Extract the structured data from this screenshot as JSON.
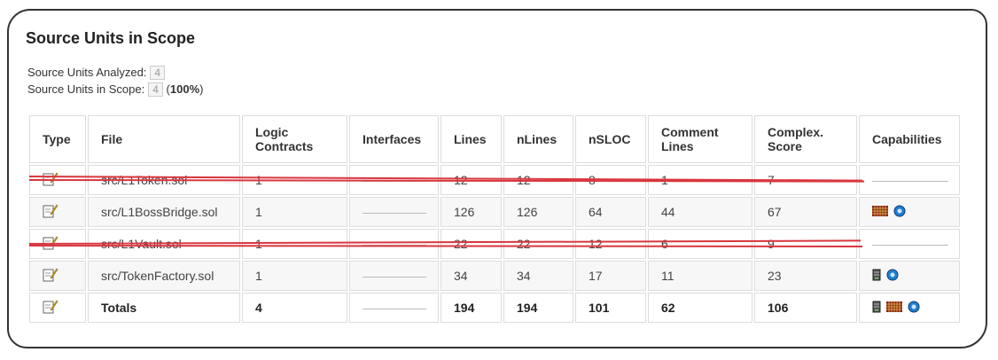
{
  "section_title": "Source Units in Scope",
  "analyzed": {
    "label": "Source Units Analyzed:",
    "value": "4"
  },
  "in_scope": {
    "label": "Source Units in Scope:",
    "value": "4",
    "percent_open": "(",
    "percent": "100%",
    "percent_close": ")"
  },
  "table": {
    "headers": [
      "Type",
      "File",
      "Logic Contracts",
      "Interfaces",
      "Lines",
      "nLines",
      "nSLOC",
      "Comment Lines",
      "Complex. Score",
      "Capabilities"
    ],
    "rows": [
      {
        "file": "src/L1Token.sol",
        "logic": "1",
        "lines": "12",
        "nlines": "12",
        "nsloc": "8",
        "comment": "1",
        "complex": "7",
        "struck": true
      },
      {
        "file": "src/L1BossBridge.sol",
        "logic": "1",
        "lines": "126",
        "nlines": "126",
        "nsloc": "64",
        "comment": "44",
        "complex": "67",
        "struck": false
      },
      {
        "file": "src/L1Vault.sol",
        "logic": "1",
        "lines": "22",
        "nlines": "22",
        "nsloc": "12",
        "comment": "6",
        "complex": "9",
        "struck": true
      },
      {
        "file": "src/TokenFactory.sol",
        "logic": "1",
        "lines": "34",
        "nlines": "34",
        "nsloc": "17",
        "comment": "11",
        "complex": "23",
        "struck": false
      }
    ],
    "totals": {
      "label": "Totals",
      "logic": "4",
      "lines": "194",
      "nlines": "194",
      "nsloc": "101",
      "comment": "62",
      "complex": "106"
    }
  },
  "colors": {
    "strike": "#d9363e",
    "frame": "#333333"
  }
}
